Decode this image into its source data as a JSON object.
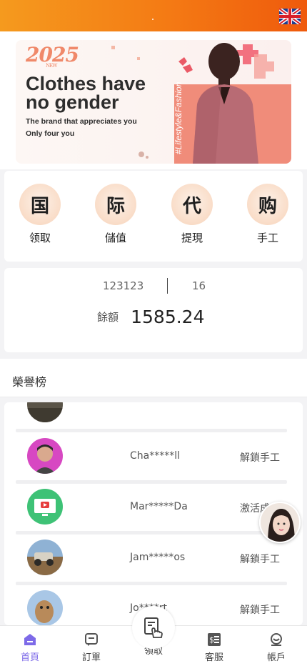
{
  "banner": {
    "year": "2025",
    "year_sub": "NEW",
    "headline": "Clothes have no gender",
    "line1": "The brand that appreciates you",
    "line2": "Only four you",
    "tag": "#Lifestyle&Fashion"
  },
  "quick": [
    {
      "char": "国",
      "label": "领取"
    },
    {
      "char": "际",
      "label": "儲值"
    },
    {
      "char": "代",
      "label": "提現"
    },
    {
      "char": "购",
      "label": "手工"
    }
  ],
  "account": {
    "id": "123123",
    "level": "16",
    "balance_label": "餘額",
    "balance": "1585.24"
  },
  "honor_title": "榮譽榜",
  "leaderboard": [
    {
      "name": "Cha*****ll",
      "action": "解鎖手工"
    },
    {
      "name": "Mar*****Da",
      "action": "激活成"
    },
    {
      "name": "Jam*****os",
      "action": "解鎖手工"
    },
    {
      "name": "Jo****rt",
      "action": "解鎖手工"
    }
  ],
  "tabs": [
    {
      "label": "首頁"
    },
    {
      "label": "訂單"
    },
    {
      "label": "領取"
    },
    {
      "label": "客服"
    },
    {
      "label": "帳戶"
    }
  ],
  "colors": {
    "accent": "#f47a14",
    "tab_active": "#7d6ae8"
  }
}
